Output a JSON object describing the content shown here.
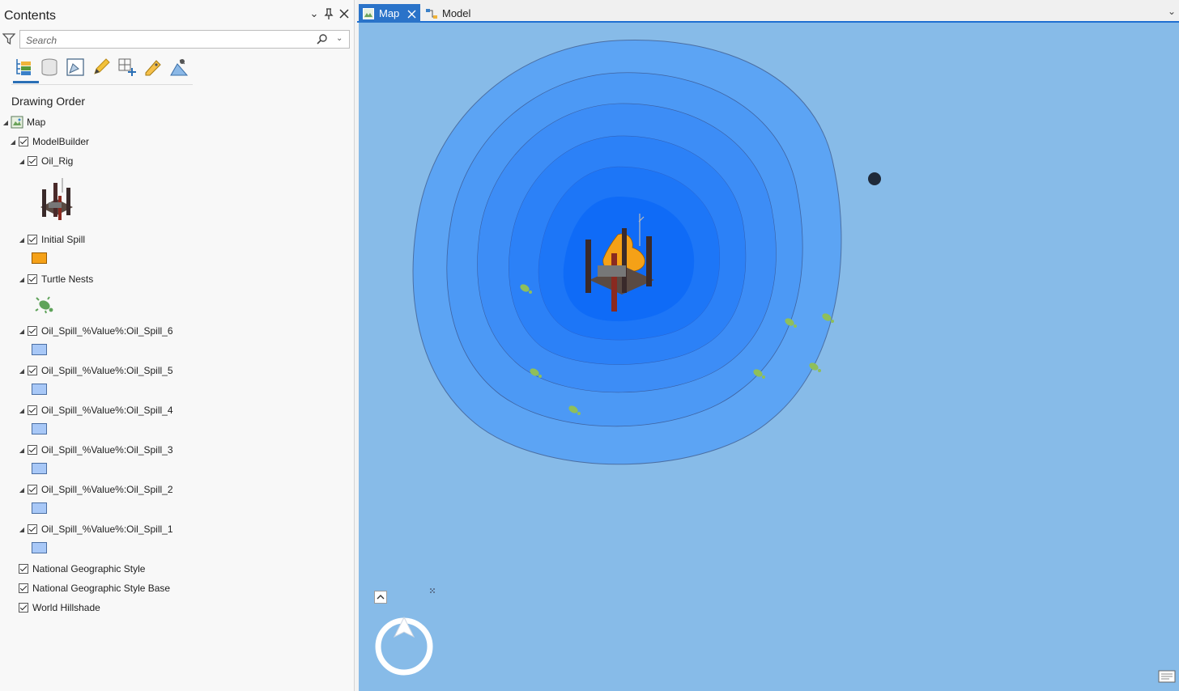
{
  "contents_pane": {
    "title": "Contents",
    "search": {
      "placeholder": "Search",
      "value": ""
    },
    "toolbar_icons": [
      "list-by-drawing-order-icon",
      "list-by-data-source-icon",
      "list-by-selection-icon",
      "list-by-editing-icon",
      "list-by-snapping-icon",
      "list-by-labeling-icon",
      "list-by-perspective-imagery-icon"
    ],
    "section_title": "Drawing Order",
    "layers": {
      "map": "Map",
      "modelbuilder": "ModelBuilder",
      "oil_rig": "Oil_Rig",
      "initial_spill": "Initial Spill",
      "turtle_nests": "Turtle Nests",
      "spill6": "Oil_Spill_%Value%:Oil_Spill_6",
      "spill5": "Oil_Spill_%Value%:Oil_Spill_5",
      "spill4": "Oil_Spill_%Value%:Oil_Spill_4",
      "spill3": "Oil_Spill_%Value%:Oil_Spill_3",
      "spill2": "Oil_Spill_%Value%:Oil_Spill_2",
      "spill1": "Oil_Spill_%Value%:Oil_Spill_1",
      "natgeo": "National Geographic Style",
      "natgeo_base": "National Geographic Style Base",
      "hillshade": "World Hillshade"
    },
    "colors": {
      "initial_spill": "#f5a117",
      "buffer_symbol": "#a8c8f7",
      "turtle": "#4f9a52"
    }
  },
  "view_tabs": {
    "map": "Map",
    "model": "Model"
  },
  "map_colors": {
    "ocean": "#87bbe8",
    "ring_1": "#5aa3f4",
    "ring_2": "#4a98f5",
    "ring_3": "#3a8cf6",
    "ring_4": "#2a80f7",
    "ring_5": "#1a74f7",
    "ring_6": "#0f6bf7"
  }
}
